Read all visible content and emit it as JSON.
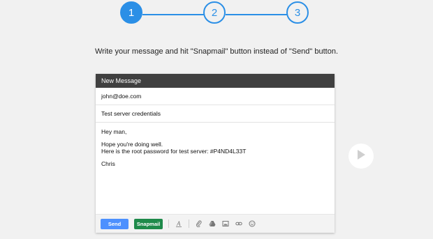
{
  "stepper": {
    "steps": [
      {
        "label": "1",
        "active": true
      },
      {
        "label": "2",
        "active": false
      },
      {
        "label": "3",
        "active": false
      }
    ],
    "accent": "#2b8fe6"
  },
  "instruction": "Write your message and hit \"Snapmail\" button instead of \"Send\" button.",
  "compose": {
    "title": "New Message",
    "to": "john@doe.com",
    "subject": "Test server credentials",
    "body": {
      "greeting": "Hey man,",
      "line1": "Hope you're doing well.",
      "line2": "Here is the root password for test server: #P4ND4L33T",
      "signature": "Chris"
    },
    "toolbar": {
      "send_label": "Send",
      "snapmail_label": "Snapmail",
      "icons": [
        "format-text-icon",
        "attach-icon",
        "drive-icon",
        "photo-icon",
        "link-icon",
        "emoji-icon"
      ]
    }
  },
  "colors": {
    "send": "#4d90fe",
    "snapmail": "#1e8a4a",
    "header": "#404040"
  },
  "play_icon": "play-icon"
}
